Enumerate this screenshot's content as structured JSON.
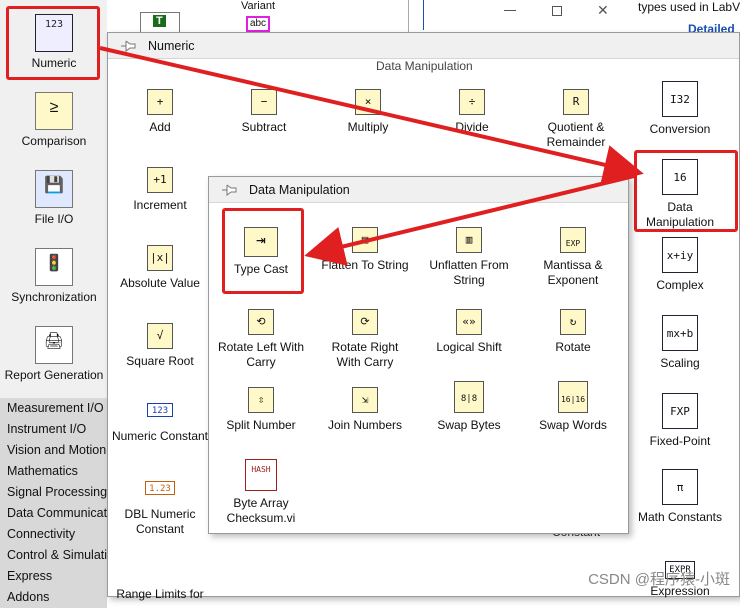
{
  "left_palette": {
    "items": [
      {
        "label": "Numeric",
        "glyph": "123"
      },
      {
        "label": "Comparison",
        "glyph": "≥"
      },
      {
        "label": "File I/O",
        "glyph": "💾"
      },
      {
        "label": "Synchronization",
        "glyph": "🚦"
      },
      {
        "label": "Report Generation",
        "glyph": "🖨"
      }
    ],
    "categories": [
      "Measurement I/O",
      "Instrument I/O",
      "Vision and Motion",
      "Mathematics",
      "Signal Processing",
      "Data Communicati",
      "Connectivity",
      "Control & Simulati",
      "Express",
      "Addons"
    ]
  },
  "top_strip": {
    "variant_label": "Variant",
    "abc_glyph": "abc",
    "T_glyph": "T"
  },
  "bg_window_text": {
    "line1": "types used in LabVI",
    "line2": "Detailed"
  },
  "numeric_panel": {
    "title": "Numeric",
    "subheader": "Data Manipulation",
    "items": [
      {
        "label": "Add",
        "glyph": "+"
      },
      {
        "label": "Subtract",
        "glyph": "−"
      },
      {
        "label": "Multiply",
        "glyph": "×"
      },
      {
        "label": "Divide",
        "glyph": "÷"
      },
      {
        "label": "Quotient & Remainder",
        "glyph": "R"
      },
      {
        "label": "Conversion",
        "glyph": "I32"
      },
      {
        "label": "Increment",
        "glyph": "+1"
      },
      {
        "label": "Data Manipulation",
        "glyph": "16"
      },
      {
        "label": "Absolute Value",
        "glyph": "|x|"
      },
      {
        "label": "Complex",
        "glyph": "x+iy"
      },
      {
        "label": "Square Root",
        "glyph": "√"
      },
      {
        "label": "Scaling",
        "glyph": "mx+b"
      },
      {
        "label": "Numeric Constant",
        "glyph": "123"
      },
      {
        "label": "Fixed-Point",
        "glyph": "FXP"
      },
      {
        "label": "DBL Numeric Constant",
        "glyph": "1.23"
      },
      {
        "label": "Math Constants",
        "glyph": "π"
      },
      {
        "label": "Range Limits for",
        "glyph": ""
      },
      {
        "label": "Expression",
        "glyph": "EXPR"
      }
    ],
    "hidden_label": "Constant"
  },
  "data_manip_panel": {
    "title": "Data Manipulation",
    "items": [
      {
        "label": "Type Cast",
        "glyph": "⇥"
      },
      {
        "label": "Flatten To String",
        "glyph": "▤"
      },
      {
        "label": "Unflatten From String",
        "glyph": "▥"
      },
      {
        "label": "Mantissa & Exponent",
        "glyph": "EXP"
      },
      {
        "label": "Rotate Left With Carry",
        "glyph": "⟲"
      },
      {
        "label": "Rotate Right With Carry",
        "glyph": "⟳"
      },
      {
        "label": "Logical Shift",
        "glyph": "«»"
      },
      {
        "label": "Rotate",
        "glyph": "↻"
      },
      {
        "label": "Split Number",
        "glyph": "⇳"
      },
      {
        "label": "Join Numbers",
        "glyph": "⇲"
      },
      {
        "label": "Swap Bytes",
        "glyph": "8|8"
      },
      {
        "label": "Swap Words",
        "glyph": "16|16"
      },
      {
        "label": "Byte Array Checksum.vi",
        "glyph": "HASH"
      }
    ]
  },
  "watermark": "CSDN @程序猿-小斑",
  "colors": {
    "highlight": "#e02020",
    "arrow": "#e02020",
    "icon_fill": "#fff8c8"
  }
}
